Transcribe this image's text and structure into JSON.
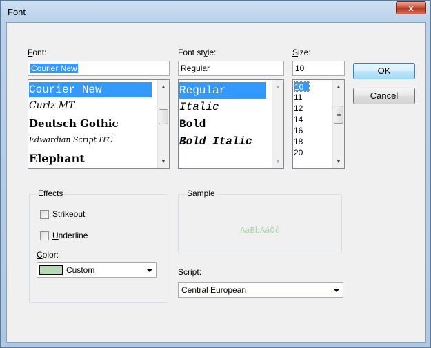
{
  "window": {
    "title": "Font",
    "close_glyph": "x"
  },
  "font": {
    "label_prefix": "",
    "label_underline": "F",
    "label_rest": "ont:",
    "value": "Courier New",
    "items": [
      "Courier New",
      "Curlz MT",
      "Deutsch Gothic",
      "Edwardian Script ITC",
      "Elephant"
    ]
  },
  "style": {
    "label_prefix": "Font st",
    "label_underline": "y",
    "label_rest": "le:",
    "value": "Regular",
    "items": [
      "Regular",
      "Italic",
      "Bold",
      "Bold Italic"
    ]
  },
  "size": {
    "label_underline": "S",
    "label_rest": "ize:",
    "value": "10",
    "items": [
      "10",
      "11",
      "12",
      "14",
      "16",
      "18",
      "20"
    ]
  },
  "buttons": {
    "ok": "OK",
    "cancel": "Cancel"
  },
  "effects": {
    "title": "Effects",
    "strikeout_prefix": "Stri",
    "strikeout_underline": "k",
    "strikeout_rest": "eout",
    "underline_underline": "U",
    "underline_rest": "nderline",
    "color_underline": "C",
    "color_rest": "olor:",
    "color_value": "Custom",
    "color_swatch": "#b8d8b8"
  },
  "sample": {
    "title": "Sample",
    "text": "AaBbÁáÔô",
    "text_color": "#a9d4a9"
  },
  "script": {
    "label_prefix": "Sc",
    "label_underline": "r",
    "label_rest": "ipt:",
    "value": "Central European"
  }
}
